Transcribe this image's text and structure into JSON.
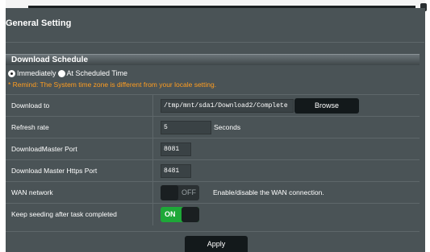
{
  "page": {
    "title": "General Setting"
  },
  "schedule": {
    "section_title": "Download Schedule",
    "options": [
      "Immediately",
      "At Scheduled Time"
    ],
    "selected": "Immediately",
    "remind": "* Remind: The System time zone is different from your locale setting."
  },
  "rows": {
    "download_to": {
      "label": "Download to",
      "value": "/tmp/mnt/sda1/Download2/Complete",
      "button": "Browse"
    },
    "refresh_rate": {
      "label": "Refresh rate",
      "value": "5",
      "unit": "Seconds"
    },
    "dm_port": {
      "label": "DownloadMaster Port",
      "value": "8081"
    },
    "dm_https_port": {
      "label": "Download Master Https Port",
      "value": "8481"
    },
    "wan": {
      "label": "WAN network",
      "state": "OFF",
      "description": "Enable/disable the WAN connection."
    },
    "seeding": {
      "label": "Keep seeding after task completed",
      "state": "ON"
    }
  },
  "actions": {
    "apply": "Apply"
  },
  "colors": {
    "panel_bg": "#4a5356",
    "remind_text": "#ff9d20",
    "toggle_on": "#1ea838",
    "button_bg": "#13191b"
  }
}
